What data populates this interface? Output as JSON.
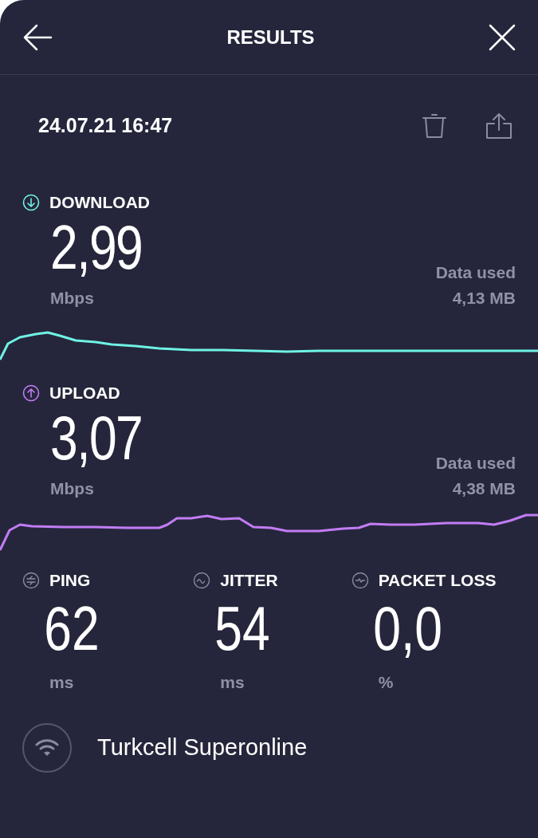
{
  "header": {
    "title": "RESULTS"
  },
  "date": "24.07.21 16:47",
  "tests": [
    {
      "kind": "download",
      "label": "DOWNLOAD",
      "value": "2,99",
      "unit": "Mbps",
      "data_label": "Data used",
      "data_value": "4,13 MB",
      "color": "#6ff2e6"
    },
    {
      "kind": "upload",
      "label": "UPLOAD",
      "value": "3,07",
      "unit": "Mbps",
      "data_label": "Data used",
      "data_value": "4,38 MB",
      "color": "#c27cf5"
    }
  ],
  "metrics": [
    {
      "kind": "ping",
      "label": "PING",
      "value": "62",
      "unit": "ms"
    },
    {
      "kind": "jitter",
      "label": "JITTER",
      "value": "54",
      "unit": "ms"
    },
    {
      "kind": "loss",
      "label": "PACKET LOSS",
      "value": "0,0",
      "unit": "%"
    }
  ],
  "provider": "Turkcell Superonline"
}
